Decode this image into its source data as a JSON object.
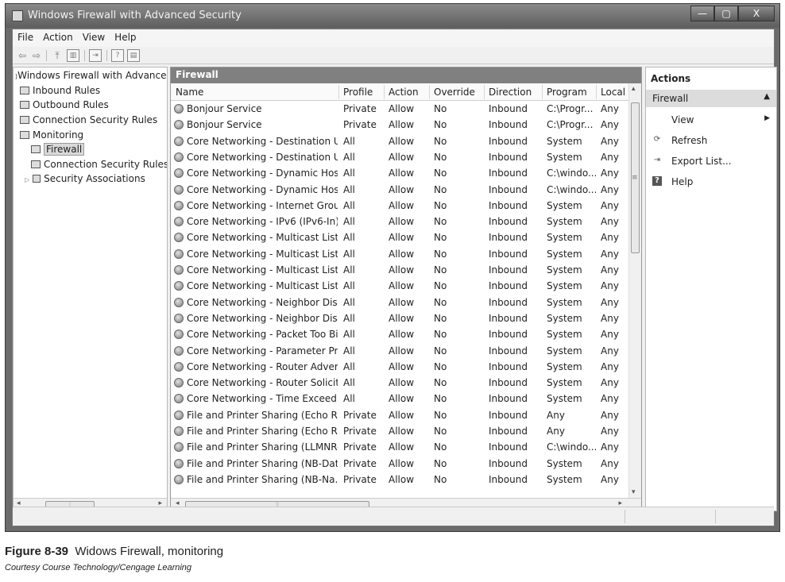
{
  "window": {
    "title": "Windows Firewall with Advanced Security"
  },
  "window_buttons": [
    "—",
    "▢",
    "X"
  ],
  "menu": [
    "File",
    "Action",
    "View",
    "Help"
  ],
  "tree": [
    {
      "label": "Windows Firewall with Advanced",
      "icon": "firewall-icon"
    },
    {
      "label": "Inbound Rules",
      "icon": "inbound-rules-icon"
    },
    {
      "label": "Outbound Rules",
      "icon": "outbound-rules-icon"
    },
    {
      "label": "Connection Security Rules",
      "icon": "connection-security-icon"
    },
    {
      "label": "Monitoring",
      "icon": "monitoring-icon"
    },
    {
      "label": "Firewall",
      "icon": "firewall-icon",
      "selected": true
    },
    {
      "label": "Connection Security Rules",
      "icon": "connection-security-icon"
    },
    {
      "label": "Security Associations",
      "icon": "lock-icon"
    }
  ],
  "center": {
    "title": "Firewall",
    "columns": [
      "Name",
      "Profile",
      "Action",
      "Override",
      "Direction",
      "Program",
      "Local"
    ],
    "rows": [
      [
        "Bonjour Service",
        "Private",
        "Allow",
        "No",
        "Inbound",
        "C:\\Progr...",
        "Any"
      ],
      [
        "Bonjour Service",
        "Private",
        "Allow",
        "No",
        "Inbound",
        "C:\\Progr...",
        "Any"
      ],
      [
        "Core Networking - Destination U...",
        "All",
        "Allow",
        "No",
        "Inbound",
        "System",
        "Any"
      ],
      [
        "Core Networking - Destination U...",
        "All",
        "Allow",
        "No",
        "Inbound",
        "System",
        "Any"
      ],
      [
        "Core Networking - Dynamic Hos...",
        "All",
        "Allow",
        "No",
        "Inbound",
        "C:\\windo...",
        "Any"
      ],
      [
        "Core Networking - Dynamic Hos...",
        "All",
        "Allow",
        "No",
        "Inbound",
        "C:\\windo...",
        "Any"
      ],
      [
        "Core Networking - Internet Grou...",
        "All",
        "Allow",
        "No",
        "Inbound",
        "System",
        "Any"
      ],
      [
        "Core Networking - IPv6 (IPv6-In)",
        "All",
        "Allow",
        "No",
        "Inbound",
        "System",
        "Any"
      ],
      [
        "Core Networking - Multicast List...",
        "All",
        "Allow",
        "No",
        "Inbound",
        "System",
        "Any"
      ],
      [
        "Core Networking - Multicast List...",
        "All",
        "Allow",
        "No",
        "Inbound",
        "System",
        "Any"
      ],
      [
        "Core Networking - Multicast List...",
        "All",
        "Allow",
        "No",
        "Inbound",
        "System",
        "Any"
      ],
      [
        "Core Networking - Multicast List...",
        "All",
        "Allow",
        "No",
        "Inbound",
        "System",
        "Any"
      ],
      [
        "Core Networking - Neighbor Dis...",
        "All",
        "Allow",
        "No",
        "Inbound",
        "System",
        "Any"
      ],
      [
        "Core Networking - Neighbor Dis...",
        "All",
        "Allow",
        "No",
        "Inbound",
        "System",
        "Any"
      ],
      [
        "Core Networking - Packet Too Bi...",
        "All",
        "Allow",
        "No",
        "Inbound",
        "System",
        "Any"
      ],
      [
        "Core Networking - Parameter Pr...",
        "All",
        "Allow",
        "No",
        "Inbound",
        "System",
        "Any"
      ],
      [
        "Core Networking - Router Adver...",
        "All",
        "Allow",
        "No",
        "Inbound",
        "System",
        "Any"
      ],
      [
        "Core Networking - Router Solicit...",
        "All",
        "Allow",
        "No",
        "Inbound",
        "System",
        "Any"
      ],
      [
        "Core Networking - Time Exceed...",
        "All",
        "Allow",
        "No",
        "Inbound",
        "System",
        "Any"
      ],
      [
        "File and Printer Sharing (Echo Re...",
        "Private",
        "Allow",
        "No",
        "Inbound",
        "Any",
        "Any"
      ],
      [
        "File and Printer Sharing (Echo Re...",
        "Private",
        "Allow",
        "No",
        "Inbound",
        "Any",
        "Any"
      ],
      [
        "File and Printer Sharing (LLMNR-...",
        "Private",
        "Allow",
        "No",
        "Inbound",
        "C:\\windo...",
        "Any"
      ],
      [
        "File and Printer Sharing (NB-Dat...",
        "Private",
        "Allow",
        "No",
        "Inbound",
        "System",
        "Any"
      ],
      [
        "File and Printer Sharing (NB-Na...",
        "Private",
        "Allow",
        "No",
        "Inbound",
        "System",
        "Any"
      ]
    ]
  },
  "actions": {
    "title": "Actions",
    "section": "Firewall",
    "items": [
      {
        "label": "View",
        "icon": "",
        "submenu": true
      },
      {
        "label": "Refresh",
        "icon": "refresh-icon"
      },
      {
        "label": "Export List...",
        "icon": "export-icon"
      },
      {
        "label": "Help",
        "icon": "help-icon"
      }
    ]
  },
  "caption": {
    "figure_number": "Figure 8-39",
    "figure_title": "Widows Firewall, monitoring",
    "credit": "Courtesy Course Technology/Cengage Learning"
  }
}
